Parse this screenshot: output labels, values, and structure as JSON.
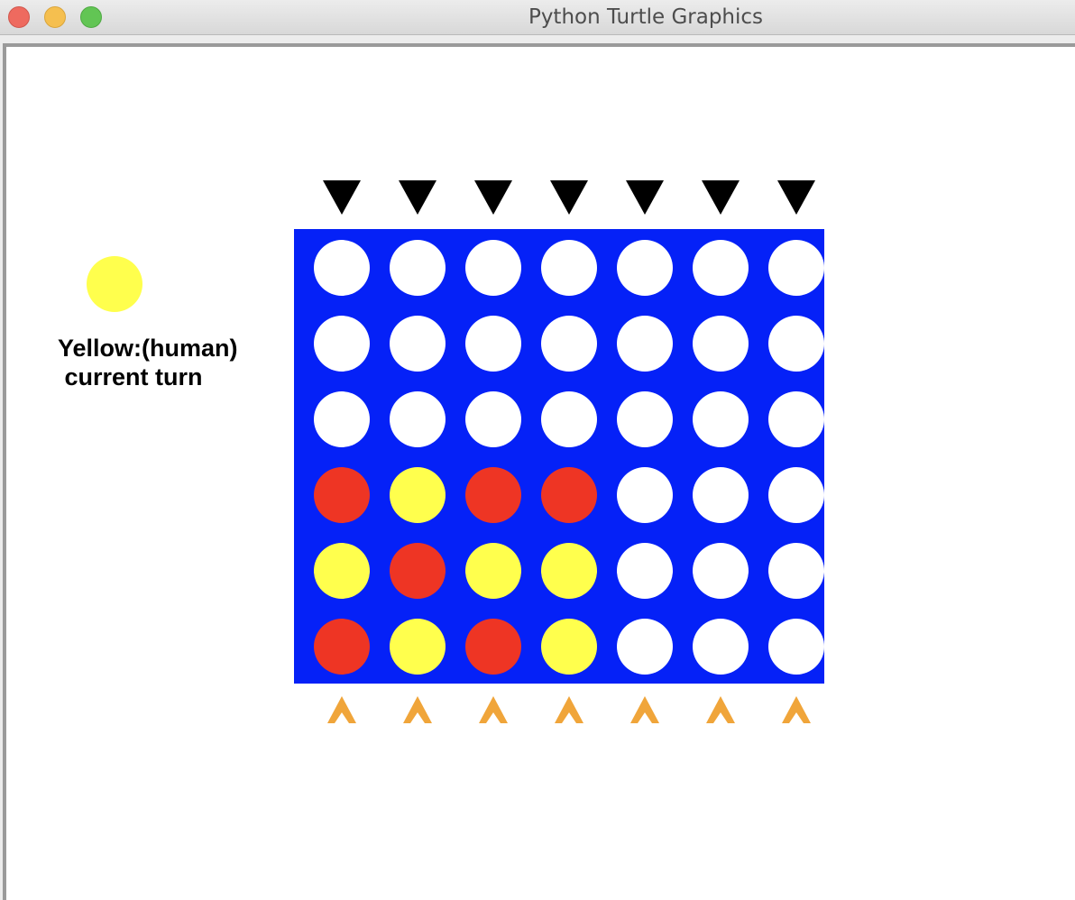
{
  "window": {
    "title": "Python Turtle Graphics"
  },
  "colors": {
    "board": "#0521f7",
    "red": "#ee3524",
    "yellow": "#ffff4d",
    "empty": "#ffffff",
    "drop_arrow": "#000000",
    "column_marker": "#f0a53a"
  },
  "status": {
    "line1": "Yellow:(human)",
    "line2": " current turn",
    "current_piece": "yellow"
  },
  "game": {
    "columns": 7,
    "rows": 6,
    "grid": [
      [
        "empty",
        "empty",
        "empty",
        "empty",
        "empty",
        "empty",
        "empty"
      ],
      [
        "empty",
        "empty",
        "empty",
        "empty",
        "empty",
        "empty",
        "empty"
      ],
      [
        "empty",
        "empty",
        "empty",
        "empty",
        "empty",
        "empty",
        "empty"
      ],
      [
        "red",
        "yellow",
        "red",
        "red",
        "empty",
        "empty",
        "empty"
      ],
      [
        "yellow",
        "red",
        "yellow",
        "yellow",
        "empty",
        "empty",
        "empty"
      ],
      [
        "red",
        "yellow",
        "red",
        "yellow",
        "empty",
        "empty",
        "empty"
      ]
    ]
  }
}
